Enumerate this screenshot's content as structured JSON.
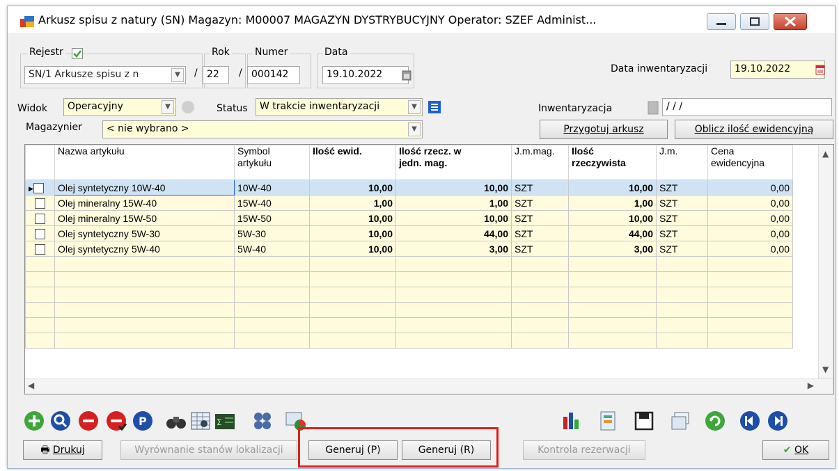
{
  "window": {
    "title": "Arkusz spisu z natury (SN)  Magazyn: M00007 MAGAZYN DYSTRYBUCYJNY  Operator: SZEF Administ..."
  },
  "header": {
    "rejestr_label": "Rejestr",
    "rejestr_value": "SN/1 Arkusze spisu z n",
    "rok_label": "Rok",
    "rok_value": "22",
    "numer_label": "Numer",
    "numer_value": "000142",
    "data_label": "Data",
    "data_value": "19.10.2022",
    "data_inw_label": "Data inwentaryzacji",
    "data_inw_value": "19.10.2022",
    "slash": "/"
  },
  "filters": {
    "widok_label": "Widok",
    "widok_value": "Operacyjny",
    "status_label": "Status",
    "status_value": "W trakcie inwentaryzacji",
    "inwentaryzacja_label": "Inwentaryzacja",
    "inwentaryzacja_value": "/ / /",
    "magazynier_label": "Magazynier",
    "magazynier_value": "< nie wybrano >",
    "przygotuj_button": "Przygotuj arkusz",
    "oblicz_button": "Oblicz ilość ewidencyjną"
  },
  "grid": {
    "columns": [
      "Nazwa artykułu",
      "Symbol artykułu",
      "Ilość ewid.",
      "Ilość rzecz. w jedn. mag.",
      "J.m.mag.",
      "Ilość rzeczywista",
      "J.m.",
      "Cena ewidencyjna"
    ],
    "col_hdr": {
      "c0": "Nazwa artykułu",
      "c1a": "Symbol",
      "c1b": "artykułu",
      "c2": "Ilość ewid.",
      "c3a": "Ilość rzecz. w",
      "c3b": "jedn. mag.",
      "c4": "J.m.mag.",
      "c5a": "Ilość",
      "c5b": "rzeczywista",
      "c6": "J.m.",
      "c7a": "Cena",
      "c7b": "ewidencyjna"
    },
    "rows": [
      {
        "name": "Olej syntetyczny 10W-40",
        "symbol": "10W-40",
        "ewid": "10,00",
        "rzecz_mag": "10,00",
        "jm_mag": "SZT",
        "rzecz": "10,00",
        "jm": "SZT",
        "cena": "0,00"
      },
      {
        "name": "Olej mineralny 15W-40",
        "symbol": "15W-40",
        "ewid": "1,00",
        "rzecz_mag": "1,00",
        "jm_mag": "SZT",
        "rzecz": "1,00",
        "jm": "SZT",
        "cena": "0,00"
      },
      {
        "name": "Olej mineralny 15W-50",
        "symbol": "15W-50",
        "ewid": "10,00",
        "rzecz_mag": "10,00",
        "jm_mag": "SZT",
        "rzecz": "10,00",
        "jm": "SZT",
        "cena": "0,00"
      },
      {
        "name": "Olej syntetyczny 5W-30",
        "symbol": "5W-30",
        "ewid": "10,00",
        "rzecz_mag": "44,00",
        "jm_mag": "SZT",
        "rzecz": "44,00",
        "jm": "SZT",
        "cena": "0,00"
      },
      {
        "name": "Olej syntetyczny 5W-40",
        "symbol": "5W-40",
        "ewid": "10,00",
        "rzecz_mag": "3,00",
        "jm_mag": "SZT",
        "rzecz": "3,00",
        "jm": "SZT",
        "cena": "0,00"
      }
    ]
  },
  "footer": {
    "drukuj": "Drukuj",
    "wyrownanie": "Wyrównanie stanów lokalizacji",
    "generuj_p": "Generuj (P)",
    "generuj_r": "Generuj (R)",
    "kontrola": "Kontrola rezerwacji",
    "ok": "OK"
  },
  "colors": {
    "field_bg": "#fffcd8",
    "selected_row": "#cfe3f5",
    "highlight_box": "#e0201a"
  }
}
